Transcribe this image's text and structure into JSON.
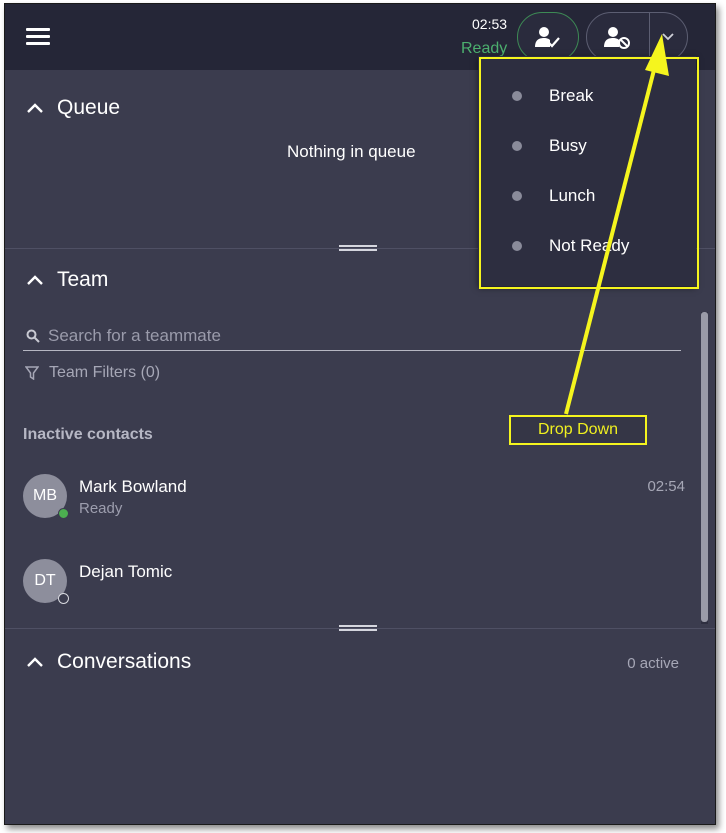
{
  "header": {
    "timer": "02:53",
    "status": "Ready",
    "accent": "#4caf6e"
  },
  "queue": {
    "title": "Queue",
    "empty_message": "Nothing in queue"
  },
  "team": {
    "title": "Team",
    "search_placeholder": "Search for a teammate",
    "filters_label": "Team Filters (0)",
    "inactive_label": "Inactive contacts",
    "contacts": [
      {
        "initials": "MB",
        "name": "Mark Bowland",
        "status": "Ready",
        "time": "02:54",
        "presence": "online"
      },
      {
        "initials": "DT",
        "name": "Dejan Tomic",
        "status": "",
        "time": "",
        "presence": "offline"
      }
    ]
  },
  "conversations": {
    "title": "Conversations",
    "active_count": "0 active"
  },
  "status_menu": {
    "items": [
      {
        "label": "Break"
      },
      {
        "label": "Busy"
      },
      {
        "label": "Lunch"
      },
      {
        "label": "Not Ready"
      }
    ]
  },
  "annotation": {
    "callout": "Drop Down",
    "color": "#f5f51e"
  }
}
